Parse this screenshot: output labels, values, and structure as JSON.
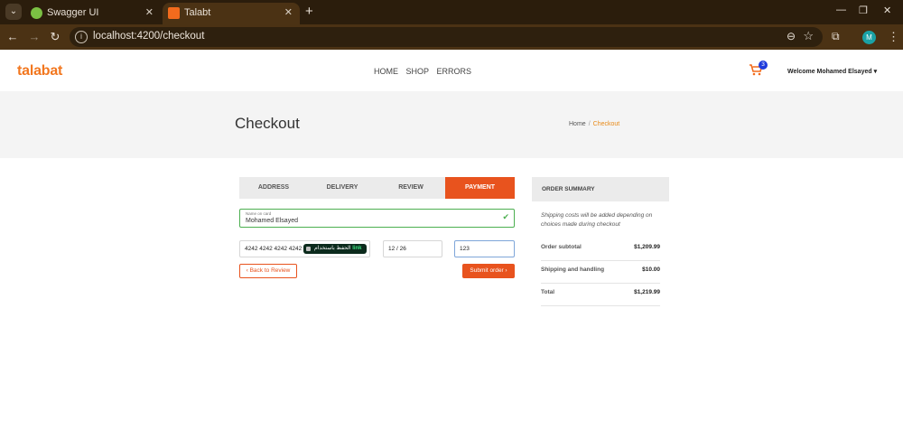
{
  "browser": {
    "tabs": [
      {
        "title": "Swagger UI",
        "close": "✕"
      },
      {
        "title": "Talabt",
        "close": "✕"
      }
    ],
    "new_tab": "+",
    "url": "localhost:4200/checkout",
    "profile_initial": "M"
  },
  "header": {
    "logo": "talabat",
    "nav": [
      "HOME",
      "SHOP",
      "ERRORS"
    ],
    "cart_count": "3",
    "welcome": "Welcome Mohamed Elsayed ▾"
  },
  "hero": {
    "title": "Checkout",
    "breadcrumb": {
      "home": "Home",
      "sep": "/",
      "current": "Checkout"
    }
  },
  "steps": [
    "ADDRESS",
    "DELIVERY",
    "REVIEW",
    "PAYMENT"
  ],
  "payment": {
    "name_label": "Name on card",
    "name_value": "Mohamed Elsayed",
    "card_number": "4242 4242 4242 4242",
    "link_text": "الحفظ باستخدام",
    "link_brand": "link",
    "expiry": "12 / 26",
    "cvc": "123",
    "back_label": "‹ Back to Review",
    "submit_label": "Submit order ›"
  },
  "summary": {
    "title": "ORDER SUMMARY",
    "note": "Shipping costs will be added depending on choices made during checkout",
    "rows": [
      {
        "label": "Order subtotal",
        "value": "$1,209.99"
      },
      {
        "label": "Shipping and handling",
        "value": "$10.00"
      },
      {
        "label": "Total",
        "value": "$1,219.99"
      }
    ]
  },
  "colors": {
    "accent": "#e8531e",
    "logo": "#f2771f",
    "valid": "#4caf50",
    "chrome_dark": "#2b1d0c",
    "chrome_toolbar": "#4b3214"
  }
}
